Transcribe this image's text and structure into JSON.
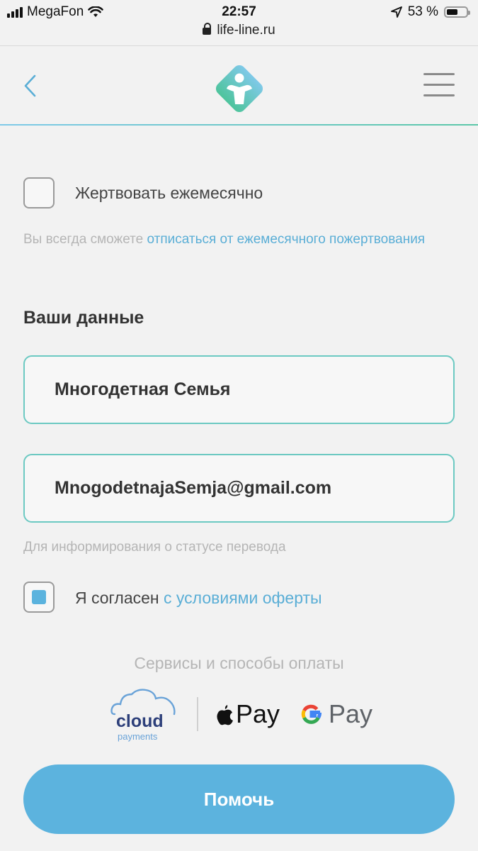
{
  "status_bar": {
    "carrier": "MegaFon",
    "time": "22:57",
    "battery": "53 %",
    "url": "life-line.ru"
  },
  "donation": {
    "monthly_label": "Жертвовать ежемесячно",
    "monthly_checked": false,
    "hint_prefix": "Вы всегда сможете ",
    "hint_link": "отписаться от ежемесячного пожертвования"
  },
  "your_data": {
    "title": "Ваши данные",
    "name_value": "Многодетная Семья",
    "email_value": "MnogodetnajaSemja@gmail.com",
    "email_hint": "Для информирования о статусе перевода"
  },
  "agreement": {
    "checked": true,
    "prefix": "Я согласен ",
    "link": "с условиями оферты"
  },
  "payment": {
    "title": "Сервисы и способы оплаты",
    "cloudpayments_text": "cloud",
    "cloudpayments_sub": "payments",
    "apple_pay": "Pay",
    "google_pay": "Pay"
  },
  "submit_label": "Помочь",
  "colors": {
    "accent": "#5cb3de",
    "field_border": "#6cc9c2",
    "logo_top": "#7fc9e8",
    "logo_bottom": "#4ec49c"
  }
}
